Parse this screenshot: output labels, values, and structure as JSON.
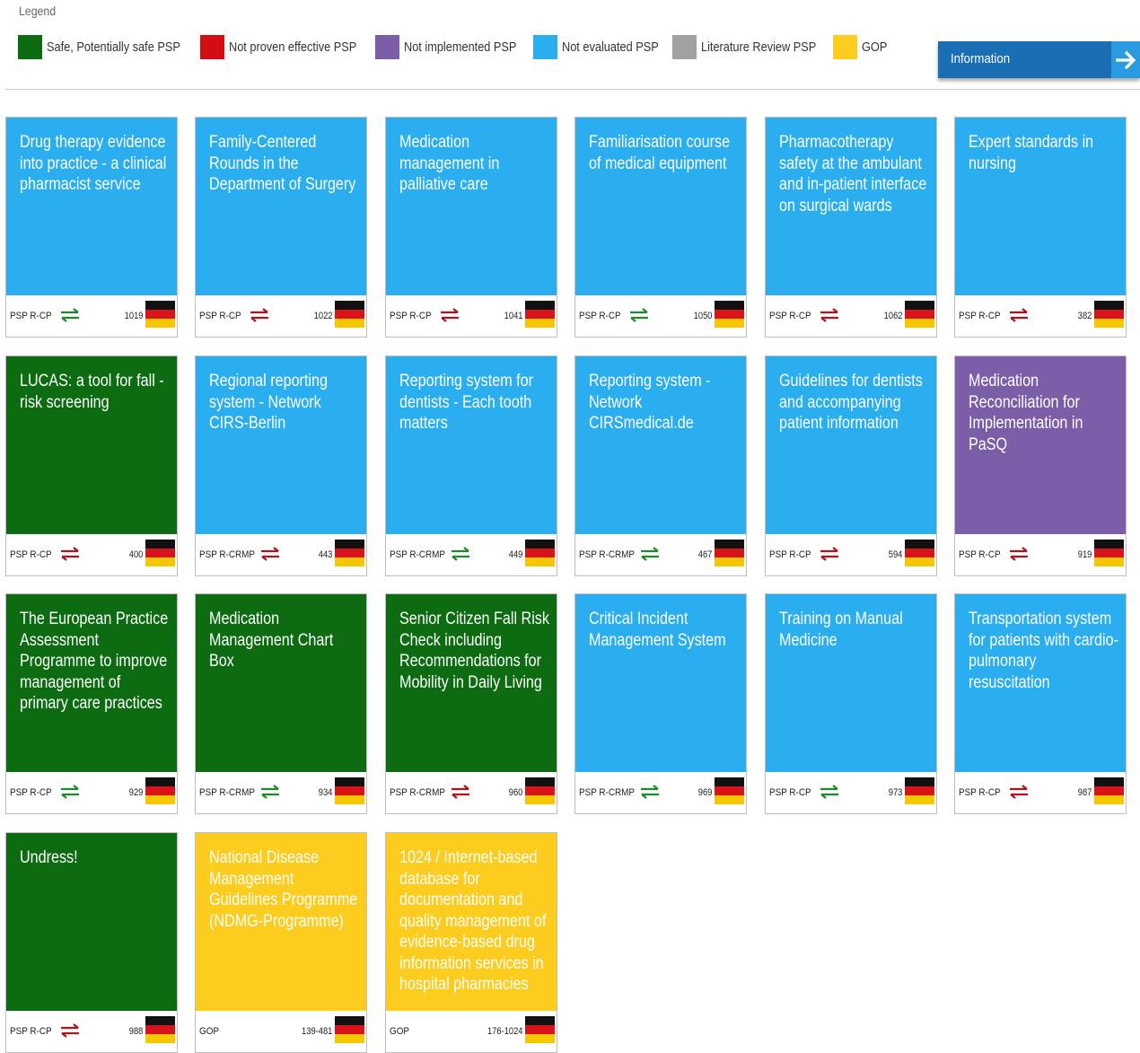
{
  "legend": {
    "title": "Legend",
    "items": [
      {
        "label": "Safe, Potentially safe PSP",
        "color": "#0d6b12"
      },
      {
        "label": "Not proven effective PSP",
        "color": "#d40d12"
      },
      {
        "label": "Not implemented PSP",
        "color": "#7b5ea7"
      },
      {
        "label": "Not evaluated PSP",
        "color": "#2aaef0"
      },
      {
        "label": "Literature Review PSP",
        "color": "#a0a0a0"
      },
      {
        "label": "GOP",
        "color": "#fccc1e"
      }
    ]
  },
  "info_button": {
    "label": "Information",
    "icon": "arrow-right-icon"
  },
  "status_colors": {
    "safe": "#0d6b12",
    "not_evaluated": "#2aaef0",
    "not_implemented": "#7b5ea7",
    "gop": "#fccc1e"
  },
  "flag": "germany-flag-icon",
  "cards": [
    {
      "title": "Drug therapy evidence into practice - a clinical pharmacist service",
      "status": "not_evaluated",
      "code": "PSP R-CP",
      "arrows": "green",
      "number": "1019"
    },
    {
      "title": "Family-Centered Rounds in the Department of Surgery",
      "status": "not_evaluated",
      "code": "PSP R-CP",
      "arrows": "red",
      "number": "1022"
    },
    {
      "title": "Medication management in palliative care",
      "status": "not_evaluated",
      "code": "PSP R-CP",
      "arrows": "red",
      "number": "1041"
    },
    {
      "title": "Familiarisation course of medical equipment",
      "status": "not_evaluated",
      "code": "PSP R-CP",
      "arrows": "green",
      "number": "1050"
    },
    {
      "title": "Pharmacotherapy safety at the ambulant and in-patient interface on surgical wards",
      "status": "not_evaluated",
      "code": "PSP R-CP",
      "arrows": "red",
      "number": "1062"
    },
    {
      "title": "Expert standards in nursing",
      "status": "not_evaluated",
      "code": "PSP R-CP",
      "arrows": "red",
      "number": "382"
    },
    {
      "title": "LUCAS: a tool for fall -risk screening",
      "status": "safe",
      "code": "PSP R-CP",
      "arrows": "red",
      "number": "400"
    },
    {
      "title": "Regional reporting system - Network CIRS-Berlin",
      "status": "not_evaluated",
      "code": "PSP R-CRMP",
      "arrows": "red",
      "number": "443"
    },
    {
      "title": "Reporting system for dentists - Each tooth matters",
      "status": "not_evaluated",
      "code": "PSP R-CRMP",
      "arrows": "green",
      "number": "449"
    },
    {
      "title": "Reporting system - Network CIRSmedical.de",
      "status": "not_evaluated",
      "code": "PSP R-CRMP",
      "arrows": "green",
      "number": "467"
    },
    {
      "title": "Guidelines for dentists and accompanying patient information",
      "status": "not_evaluated",
      "code": "PSP R-CP",
      "arrows": "red",
      "number": "594"
    },
    {
      "title": "Medication Reconciliation for Implementation in PaSQ",
      "status": "not_implemented",
      "code": "PSP R-CP",
      "arrows": "red",
      "number": "919"
    },
    {
      "title": "The European Practice Assessment Programme to improve management of primary care practices",
      "status": "safe",
      "code": "PSP R-CP",
      "arrows": "green",
      "number": "929"
    },
    {
      "title": "Medication Management Chart Box",
      "status": "safe",
      "code": "PSP R-CRMP",
      "arrows": "green",
      "number": "934"
    },
    {
      "title": "Senior Citizen Fall Risk Check including Recommendations for Mobility in Daily Living",
      "status": "safe",
      "code": "PSP R-CRMP",
      "arrows": "red",
      "number": "960"
    },
    {
      "title": "Critical Incident Management System",
      "status": "not_evaluated",
      "code": "PSP R-CRMP",
      "arrows": "green",
      "number": "969"
    },
    {
      "title": "Training on Manual Medicine",
      "status": "not_evaluated",
      "code": "PSP R-CP",
      "arrows": "green",
      "number": "973"
    },
    {
      "title": "Transportation system for patients with cardio-pulmonary resuscitation",
      "status": "not_evaluated",
      "code": "PSP R-CP",
      "arrows": "red",
      "number": "987"
    },
    {
      "title": "Undress!",
      "status": "safe",
      "code": "PSP R-CP",
      "arrows": "red",
      "number": "988"
    },
    {
      "title": "National Disease Management Guidelines Programme (NDMG-Programme)",
      "status": "gop",
      "code": "GOP",
      "arrows": "",
      "number": "139-481"
    },
    {
      "title": "1024 / Internet-based database for documentation and quality management of evidence-based drug information services in hospital pharmacies",
      "status": "gop",
      "code": "GOP",
      "arrows": "",
      "number": "176-1024"
    }
  ]
}
